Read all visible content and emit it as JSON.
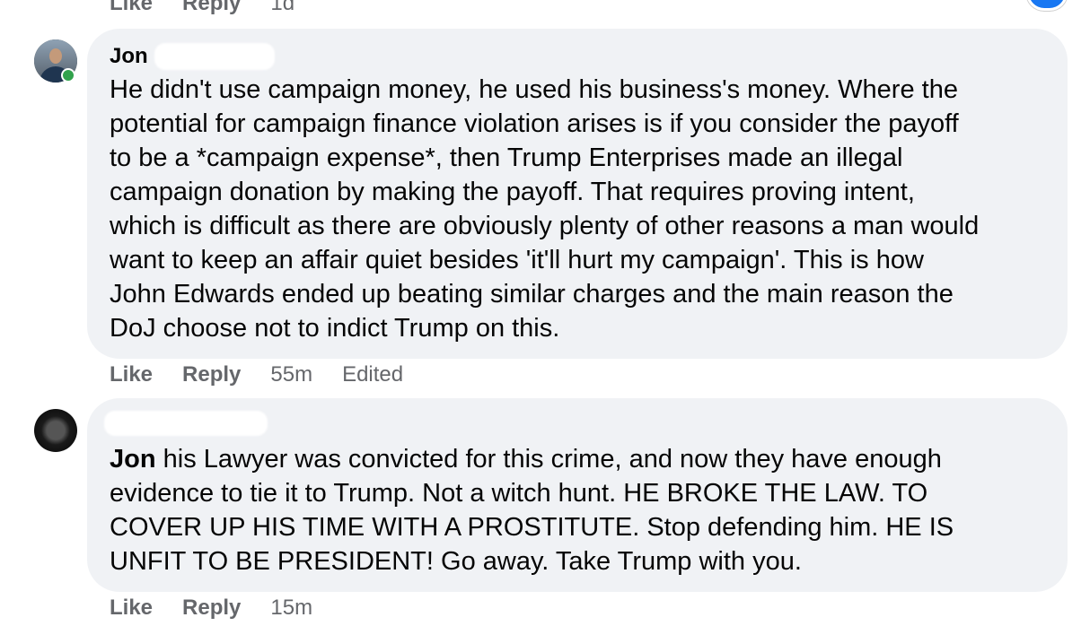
{
  "top_actions": {
    "like_label": "Like",
    "reply_label": "Reply",
    "time": "1d"
  },
  "comments": [
    {
      "author": "Jon",
      "text": "He didn't use campaign money, he used his business's money. Where the\npotential for campaign finance violation arises is if you consider the payoff\nto be a *campaign expense*, then Trump Enterprises made an illegal\ncampaign donation by making the payoff. That requires proving intent,\nwhich is difficult as there are obviously plenty of other reasons a man would\nwant to keep an affair quiet besides 'it'll hurt my campaign'. This is how\nJohn Edwards ended up beating similar charges and the main reason the\nDoJ choose not to indict Trump on this.",
      "like_label": "Like",
      "reply_label": "Reply",
      "time": "55m",
      "edited_label": "Edited",
      "online": true
    },
    {
      "mention": "Jon",
      "text": " his Lawyer was convicted for this crime, and now they have enough\nevidence to tie it to Trump. Not a witch hunt. HE BROKE THE LAW. TO\nCOVER UP HIS TIME WITH A PROSTITUTE. Stop defending him. HE IS\nUNFIT TO BE PRESIDENT! Go away. Take Trump with you.",
      "like_label": "Like",
      "reply_label": "Reply",
      "time": "15m"
    }
  ],
  "colors": {
    "bubble": "#f0f2f5",
    "meta_text": "#65676b",
    "online": "#31a24c",
    "accent": "#1877f2"
  }
}
